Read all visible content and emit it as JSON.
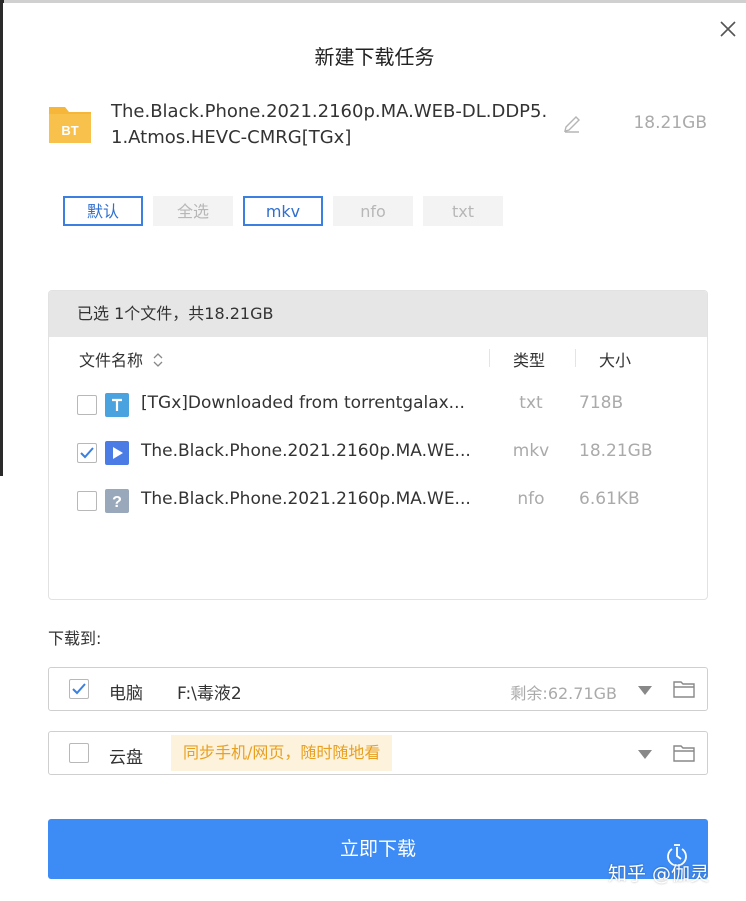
{
  "dialog": {
    "title": "新建下载任务",
    "torrent_name": "The.Black.Phone.2021.2160p.MA.WEB-DL.DDP5.1.Atmos.HEVC-CMRG[TGx]",
    "total_size": "18.21GB",
    "bt_label": "BT"
  },
  "filters": [
    {
      "label": "默认",
      "active": true
    },
    {
      "label": "全选",
      "active": false
    },
    {
      "label": "mkv",
      "active": true
    },
    {
      "label": "nfo",
      "active": false
    },
    {
      "label": "txt",
      "active": false
    }
  ],
  "file_list": {
    "summary": "已选 1个文件，共18.21GB",
    "headers": {
      "name": "文件名称",
      "type": "类型",
      "size": "大小"
    },
    "rows": [
      {
        "checked": false,
        "icon": "text-file-icon",
        "icon_color": "#4aa3df",
        "name": "[TGx]Downloaded from torrentgalax...",
        "ext": "txt",
        "size": "718B"
      },
      {
        "checked": true,
        "icon": "video-file-icon",
        "icon_color": "#4b7be5",
        "name": "The.Black.Phone.2021.2160p.MA.WE...",
        "ext": "mkv",
        "size": "18.21GB"
      },
      {
        "checked": false,
        "icon": "unknown-file-icon",
        "icon_color": "#9aa8bb",
        "name": "The.Black.Phone.2021.2160p.MA.WE...",
        "ext": "nfo",
        "size": "6.61KB"
      }
    ]
  },
  "destination": {
    "label": "下载到:",
    "pc": {
      "checked": true,
      "label": "电脑",
      "path": "F:\\毒液2",
      "free": "剩余:62.71GB"
    },
    "cloud": {
      "checked": false,
      "label": "云盘",
      "hint": "同步手机/网页，随时随地看"
    }
  },
  "download_button": {
    "label": "立即下载"
  },
  "watermark": "知乎 @伽灵",
  "colors": {
    "accent": "#3d8cf5",
    "chip_active_border": "#3b7fe0",
    "hint_bg": "#fdf2dc",
    "hint_text": "#e8a020"
  }
}
